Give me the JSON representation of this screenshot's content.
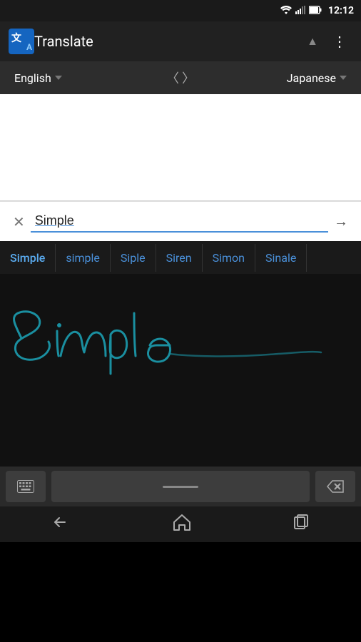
{
  "statusBar": {
    "time": "12:12",
    "icons": [
      "wifi",
      "signal",
      "battery"
    ]
  },
  "appBar": {
    "title": "Translate",
    "overflowLabel": "⋮"
  },
  "languageBar": {
    "sourceLang": "English",
    "targetLang": "Japanese",
    "swapLeft": "〈",
    "swapRight": "〉"
  },
  "inputRow": {
    "clearLabel": "✕",
    "inputValue": "Simple",
    "submitLabel": "→"
  },
  "suggestions": [
    {
      "text": "Simple",
      "active": true
    },
    {
      "text": "simple"
    },
    {
      "text": "Siple"
    },
    {
      "text": "Siren"
    },
    {
      "text": "Simon"
    },
    {
      "text": "Sinale"
    }
  ],
  "keyboardBar": {
    "keyboardIcon": "⌨",
    "deleteIcon": "⌫"
  },
  "navBar": {
    "backLabel": "◁",
    "homeLabel": "△",
    "recentLabel": "□"
  }
}
